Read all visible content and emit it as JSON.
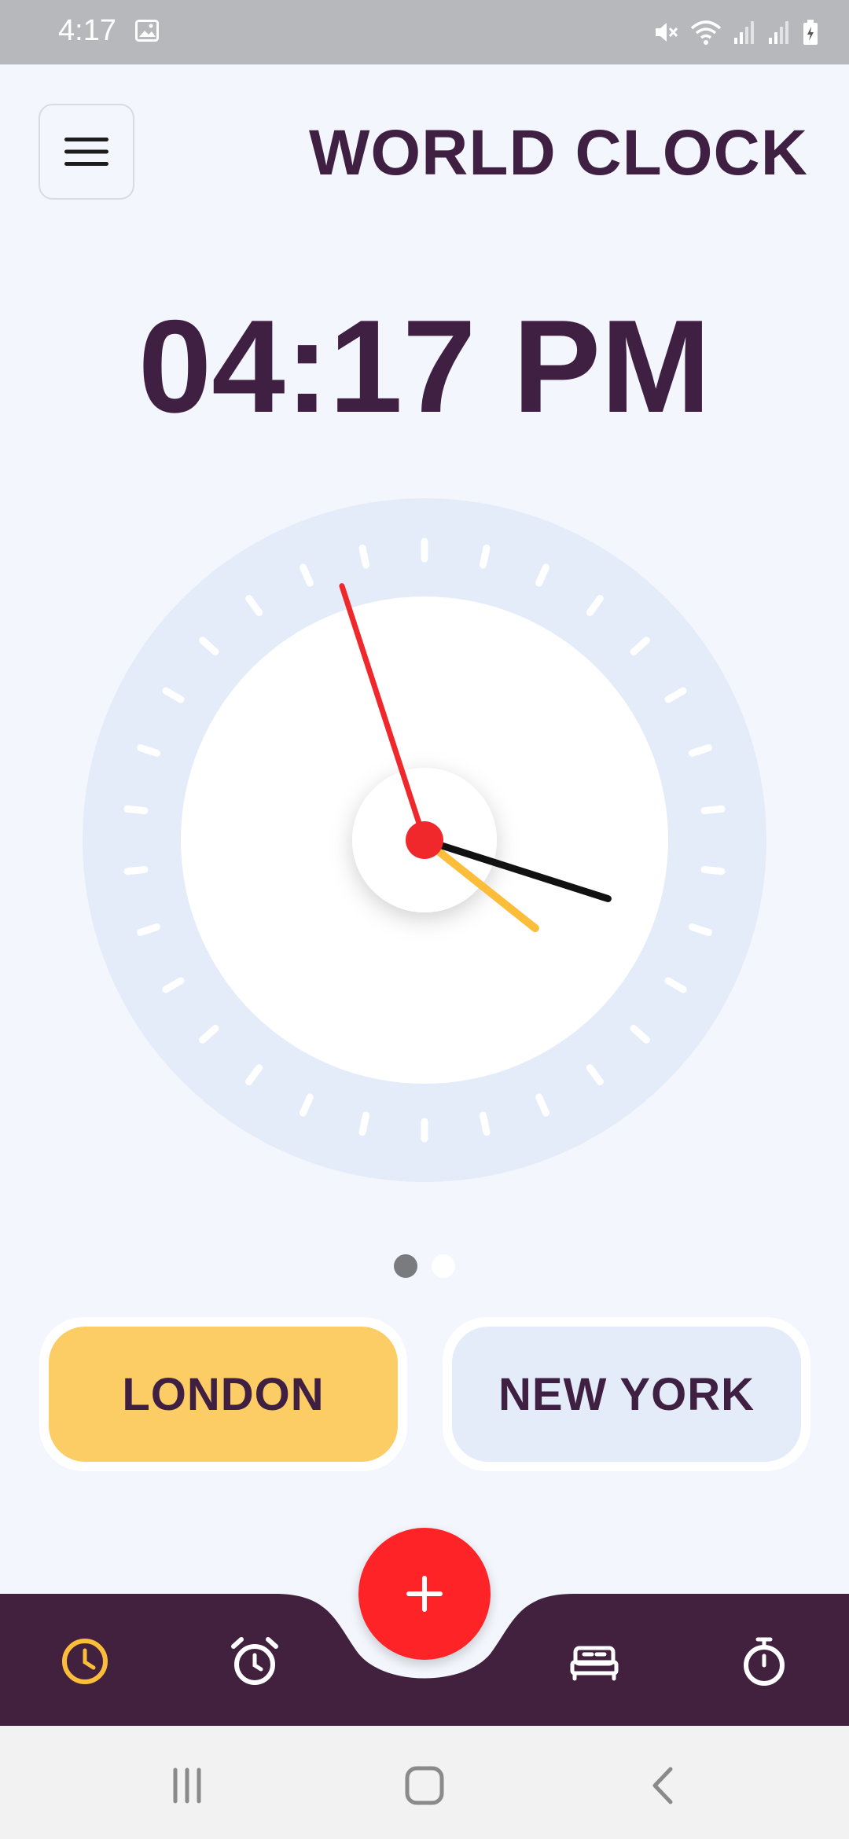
{
  "status_bar": {
    "time": "4:17",
    "icons": [
      "gallery-icon",
      "mute-icon",
      "wifi-icon",
      "signal-icon",
      "signal-icon",
      "battery-charging-icon"
    ]
  },
  "header": {
    "title": "WORLD CLOCK",
    "menu_icon": "hamburger-menu-icon"
  },
  "clock": {
    "digital_time": "04:17 PM",
    "hour": 4,
    "minute": 17,
    "second": 57,
    "colors": {
      "outer_ring": "#e4ecf9",
      "face": "#ffffff",
      "hour_hand": "#fbbd3a",
      "minute_hand": "#111111",
      "second_hand": "#f0272b",
      "center_dot": "#f0272b"
    }
  },
  "pager": {
    "count": 2,
    "active_index": 0
  },
  "cities": [
    {
      "label": "LONDON",
      "selected": true,
      "color": "#fccc65"
    },
    {
      "label": "NEW YORK",
      "selected": false,
      "color": "#e4ecf9"
    }
  ],
  "bottom_nav": {
    "background": "#42213f",
    "items": [
      {
        "icon": "clock-icon",
        "active": true
      },
      {
        "icon": "alarm-icon",
        "active": false
      },
      {
        "icon": "bed-icon",
        "active": false
      },
      {
        "icon": "stopwatch-icon",
        "active": false
      }
    ],
    "fab_icon": "plus-icon",
    "active_color": "#fbbd3a"
  },
  "system_nav": {
    "icons": [
      "recent-apps-icon",
      "home-icon",
      "back-icon"
    ]
  }
}
